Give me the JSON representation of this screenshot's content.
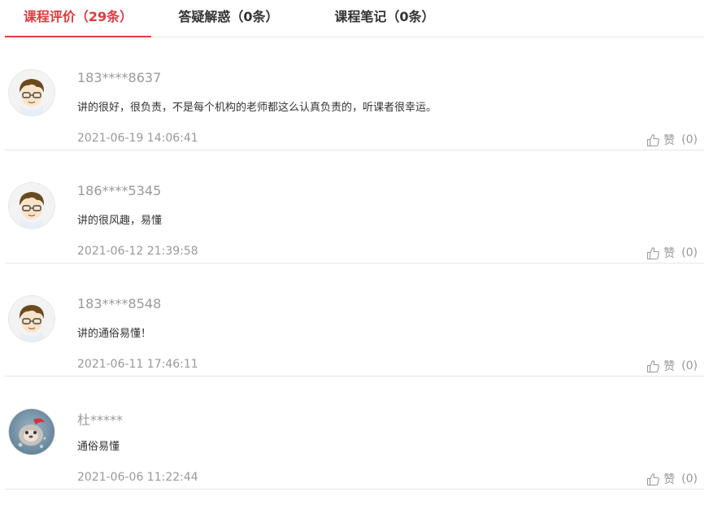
{
  "tabs": [
    {
      "label": "课程评价（29条）",
      "active": true
    },
    {
      "label": "答疑解惑（0条）",
      "active": false
    },
    {
      "label": "课程笔记（0条）",
      "active": false
    }
  ],
  "like_label": "赞",
  "comments": [
    {
      "user": "183****8637",
      "content": "讲的很好，很负责，不是每个机构的老师都这么认真负责的，听课者很幸运。",
      "time": "2021-06-19 14:06:41",
      "likes": "(0)",
      "avatar": "cartoon-boy-avatar"
    },
    {
      "user": "186****5345",
      "content": "讲的很风趣，易懂",
      "time": "2021-06-12 21:39:58",
      "likes": "(0)",
      "avatar": "cartoon-boy-avatar"
    },
    {
      "user": "183****8548",
      "content": "讲的通俗易懂！",
      "time": "2021-06-11 17:46:11",
      "likes": "(0)",
      "avatar": "cartoon-boy-avatar"
    },
    {
      "user": "杜*****",
      "content": "通俗易懂",
      "time": "2021-06-06 11:22:44",
      "likes": "(0)",
      "avatar": "cartoon-animal-avatar"
    }
  ],
  "colors": {
    "accent": "#e0393e",
    "muted": "#999999",
    "divider": "#e6e6e6"
  }
}
